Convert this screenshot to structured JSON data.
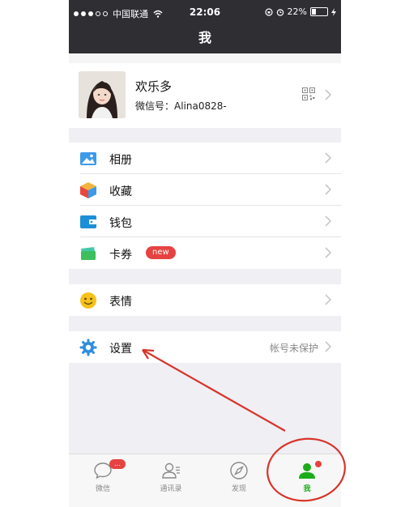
{
  "status_bar": {
    "carrier": "中国联通",
    "time": "22:06",
    "battery": "22%"
  },
  "nav": {
    "title": "我"
  },
  "profile": {
    "name": "欢乐多",
    "wechat_id": "微信号：Alina0828-"
  },
  "menu": [
    {
      "label": "相册",
      "icon": "album-icon"
    },
    {
      "label": "收藏",
      "icon": "favorites-icon"
    },
    {
      "label": "钱包",
      "icon": "wallet-icon"
    },
    {
      "label": "卡券",
      "icon": "card-coupon-icon",
      "badge": "new"
    },
    {
      "label": "表情",
      "icon": "emoji-icon"
    },
    {
      "label": "设置",
      "icon": "settings-icon",
      "right_text": "帐号未保护"
    }
  ],
  "tabbar": {
    "items": [
      {
        "label": "微信",
        "icon": "chat-icon",
        "badge": "..."
      },
      {
        "label": "通讯录",
        "icon": "contacts-icon"
      },
      {
        "label": "发现",
        "icon": "discover-compass-icon"
      },
      {
        "label": "我",
        "icon": "me-person-icon",
        "active": true
      }
    ]
  },
  "colors": {
    "header_bg": "#2e2e33",
    "accent_green": "#1aad19",
    "badge_red": "#e64340",
    "annotation_red": "#d9342b"
  }
}
